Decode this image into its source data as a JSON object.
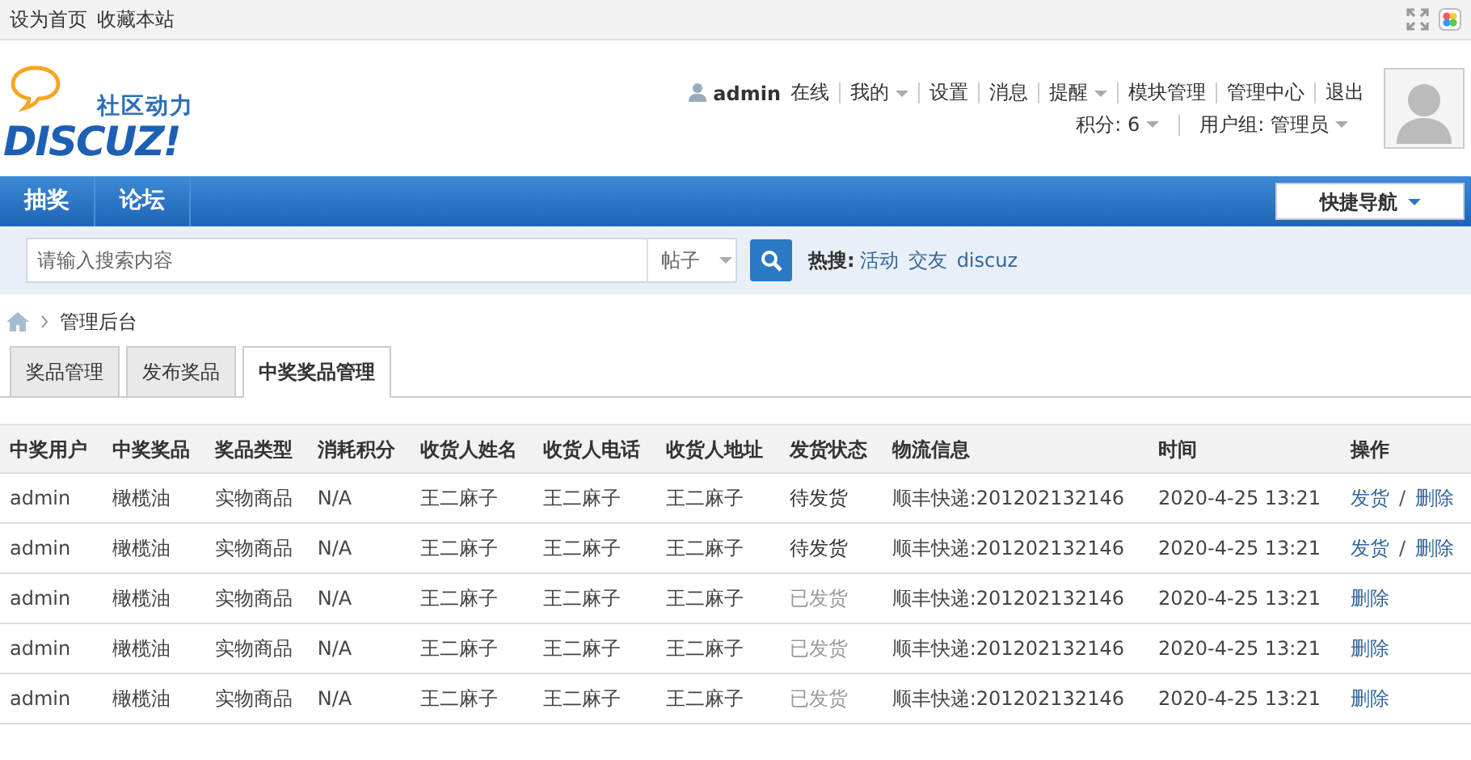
{
  "top_links": [
    "设为首页",
    "收藏本站"
  ],
  "logo": {
    "slogan": "社区动力",
    "wordmark": "DISCUZ!"
  },
  "user_menu": [
    {
      "label": "admin",
      "kind": "user"
    },
    {
      "label": "在线",
      "kind": "text"
    },
    {
      "label": "我的",
      "kind": "dropdown"
    },
    {
      "label": "设置",
      "kind": "link"
    },
    {
      "label": "消息",
      "kind": "link"
    },
    {
      "label": "提醒",
      "kind": "dropdown"
    },
    {
      "label": "模块管理",
      "kind": "link"
    },
    {
      "label": "管理中心",
      "kind": "link"
    },
    {
      "label": "退出",
      "kind": "link"
    }
  ],
  "user_stats": [
    {
      "label": "积分: 6"
    },
    {
      "label": "用户组: 管理员"
    }
  ],
  "nav": {
    "items": [
      "抽奖",
      "论坛"
    ],
    "quick_nav": "快捷导航"
  },
  "search": {
    "placeholder": "请输入搜索内容",
    "scope": "帖子",
    "hot_label": "热搜:",
    "hot_terms": [
      "活动",
      "交友",
      "discuz"
    ]
  },
  "breadcrumb": [
    "管理后台"
  ],
  "tabs": [
    {
      "label": "奖品管理",
      "selected": false
    },
    {
      "label": "发布奖品",
      "selected": false
    },
    {
      "label": "中奖奖品管理",
      "selected": true
    }
  ],
  "table": {
    "columns": [
      "中奖用户",
      "中奖奖品",
      "奖品类型",
      "消耗积分",
      "收货人姓名",
      "收货人电话",
      "收货人地址",
      "发货状态",
      "物流信息",
      "时间",
      "操作"
    ],
    "rows": [
      {
        "cells": [
          "admin",
          "橄榄油",
          "实物商品",
          "N/A",
          "王二麻子",
          "王二麻子",
          "王二麻子",
          "待发货",
          "顺丰快递:201202132146",
          "2020-4-25 13:21"
        ],
        "shipped": false,
        "actions": [
          {
            "label": "发货",
            "kind": "link"
          },
          {
            "label": "/",
            "kind": "separator"
          },
          {
            "label": "删除",
            "kind": "link"
          }
        ]
      },
      {
        "cells": [
          "admin",
          "橄榄油",
          "实物商品",
          "N/A",
          "王二麻子",
          "王二麻子",
          "王二麻子",
          "待发货",
          "顺丰快递:201202132146",
          "2020-4-25 13:21"
        ],
        "shipped": false,
        "actions": [
          {
            "label": "发货",
            "kind": "link"
          },
          {
            "label": "/",
            "kind": "separator"
          },
          {
            "label": "删除",
            "kind": "link"
          }
        ]
      },
      {
        "cells": [
          "admin",
          "橄榄油",
          "实物商品",
          "N/A",
          "王二麻子",
          "王二麻子",
          "王二麻子",
          "已发货",
          "顺丰快递:201202132146",
          "2020-4-25 13:21"
        ],
        "shipped": true,
        "actions": [
          {
            "label": "删除",
            "kind": "link"
          }
        ]
      },
      {
        "cells": [
          "admin",
          "橄榄油",
          "实物商品",
          "N/A",
          "王二麻子",
          "王二麻子",
          "王二麻子",
          "已发货",
          "顺丰快递:201202132146",
          "2020-4-25 13:21"
        ],
        "shipped": true,
        "actions": [
          {
            "label": "删除",
            "kind": "link"
          }
        ]
      },
      {
        "cells": [
          "admin",
          "橄榄油",
          "实物商品",
          "N/A",
          "王二麻子",
          "王二麻子",
          "王二麻子",
          "已发货",
          "顺丰快递:201202132146",
          "2020-4-25 13:21"
        ],
        "shipped": true,
        "actions": [
          {
            "label": "删除",
            "kind": "link"
          }
        ]
      }
    ]
  }
}
